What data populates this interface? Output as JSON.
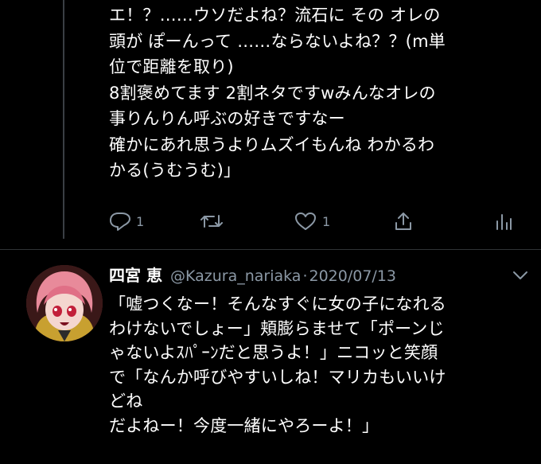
{
  "tweet1": {
    "lines": [
      "エ！？……ウソだよね？流石に その オレの",
      "頭が ぽーんって ……ならないよね？？(m単",
      "位で距離を取り)",
      "8割褒めてます 2割ネタですwみんなオレの",
      "事りんりん呼ぶの好きですなー",
      "確かにあれ思うよりムズイもんね わかるわ",
      "かる(うむうむ)」"
    ],
    "actions": {
      "reply_count": "1",
      "retweet_count": "",
      "like_count": "1"
    }
  },
  "tweet2": {
    "name": "四宮 恵",
    "handle": "@Kazura_nariaka",
    "separator": "·",
    "date": "2020/07/13",
    "lines": [
      "「嘘つくなー！そんなすぐに女の子になれる",
      "わけないでしょー」頬膨らませて「ポーンじ",
      "ゃないよｽﾊﾟｰﾝだと思うよ！」ニコッと笑顔",
      "で「なんか呼びやすいしね！マリカもいいけ",
      "どね",
      "だよねー！今度一緒にやろーよ！」"
    ]
  },
  "colors": {
    "background": "#000000",
    "text": "#ffffff",
    "muted": "#8b98a5",
    "thread_line": "#3a3f44"
  },
  "icons": [
    "reply-icon",
    "retweet-icon",
    "like-icon",
    "share-icon",
    "analytics-icon",
    "chevron-down-icon"
  ]
}
